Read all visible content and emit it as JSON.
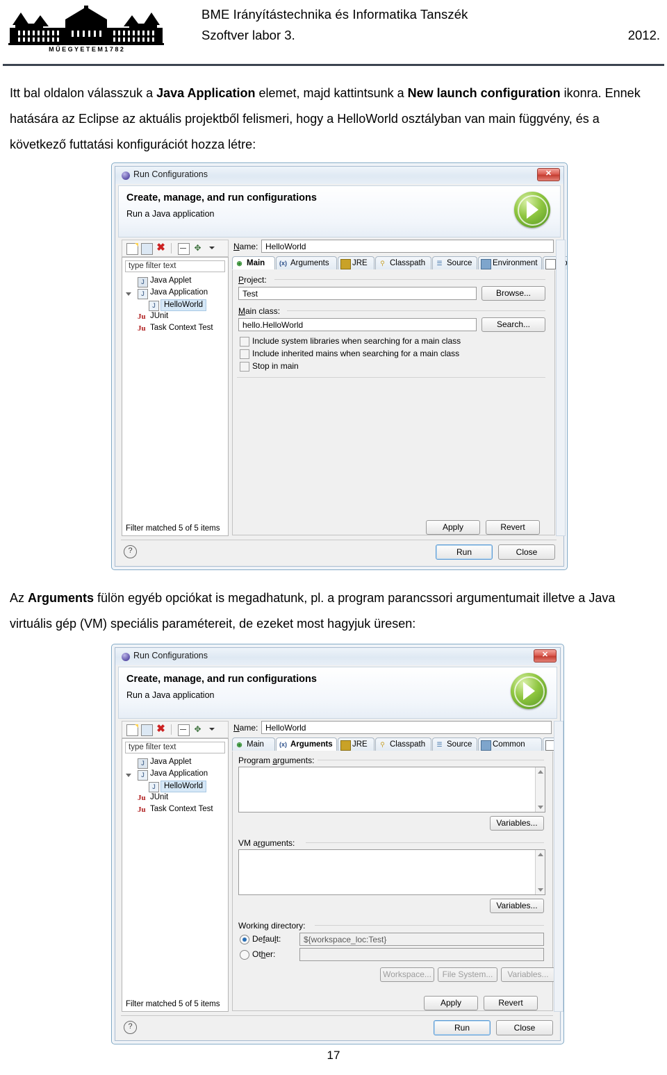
{
  "header": {
    "org": "BME Irányítástechnika és Informatika Tanszék",
    "course": "Szoftver labor 3.",
    "year": "2012.",
    "logo_caption": "M Ű E G Y E T E M  1 7 8 2"
  },
  "paragraphs": {
    "p1_a": "Itt bal oldalon válasszuk a ",
    "p1_b1": "Java Application",
    "p1_c": " elemet, majd kattintsunk a ",
    "p1_b2": "New launch configuration",
    "p1_d": " ikonra. Ennek hatására az Eclipse az aktuális projektből felismeri, hogy a HelloWorld osztályban van main függvény, és a következő futtatási konfigurációt hozza létre:",
    "p2_a": "Az ",
    "p2_b1": "Arguments",
    "p2_c": " fülön egyéb opciókat is megadhatunk, pl. a program parancssori argumentumait illetve a Java virtuális gép (VM) speciális paramétereit, de ezeket most hagyjuk üresen:"
  },
  "page_number": "17",
  "dialog": {
    "title": "Run Configurations",
    "close_label": "✕",
    "band_title": "Create, manage, and run configurations",
    "band_subtitle": "Run a Java application",
    "toolbar": {
      "new_icon": "new-launch-configuration-icon",
      "duplicate_icon": "duplicate-icon",
      "delete_icon": "✖",
      "collapse_icon": "collapse-all-icon",
      "filter_icon": "✥",
      "caret_icon": "chevron-down-icon"
    },
    "filter_placeholder": "type filter text",
    "tree": [
      {
        "label": "Java Applet",
        "icon": "J",
        "indent": 18,
        "selected": false,
        "arrow": "none"
      },
      {
        "label": "Java Application",
        "icon": "J",
        "indent": 18,
        "selected": false,
        "arrow": "open"
      },
      {
        "label": "HelloWorld",
        "icon": "J",
        "indent": 34,
        "selected": true,
        "arrow": "none"
      },
      {
        "label": "JUnit",
        "icon": "Ju",
        "indent": 18,
        "selected": false,
        "arrow": "none"
      },
      {
        "label": "Task Context Test",
        "icon": "Ju",
        "indent": 18,
        "selected": false,
        "arrow": "none"
      }
    ],
    "tree_status": "Filter matched 5 of 5 items",
    "name_label": "Name:",
    "name_value": "HelloWorld",
    "tabs": [
      {
        "label": "Main",
        "icon": "main-icon"
      },
      {
        "label": "Arguments",
        "icon": "arguments-icon"
      },
      {
        "label": "JRE",
        "icon": "jre-icon"
      },
      {
        "label": "Classpath",
        "icon": "classpath-icon"
      },
      {
        "label": "Source",
        "icon": "source-icon"
      },
      {
        "label": "Environment",
        "icon": "environment-icon"
      },
      {
        "label": "Common",
        "icon": "common-icon"
      }
    ],
    "buttons": {
      "apply": "Apply",
      "revert": "Revert",
      "run": "Run",
      "close": "Close",
      "help": "?"
    }
  },
  "main_tab": {
    "active_tab": "Main",
    "project_label": "Project:",
    "project_value": "Test",
    "browse_label": "Browse...",
    "mainclass_label": "Main class:",
    "mainclass_value": "hello.HelloWorld",
    "search_label": "Search...",
    "checkboxes": [
      {
        "label": "Include system libraries when searching for a main class",
        "checked": false
      },
      {
        "label": "Include inherited mains when searching for a main class",
        "checked": false
      },
      {
        "label": "Stop in main",
        "checked": false
      }
    ]
  },
  "arguments_tab": {
    "active_tab": "Arguments",
    "program_args_label": "Program arguments:",
    "program_args_value": "",
    "program_variables_label": "Variables...",
    "vm_args_label": "VM arguments:",
    "vm_args_value": "",
    "vm_variables_label": "Variables...",
    "working_dir_label": "Working directory:",
    "default_label": "Default:",
    "default_value": "${workspace_loc:Test}",
    "default_selected": true,
    "other_label": "Other:",
    "other_value": "",
    "other_selected": false,
    "workspace_btn": "Workspace...",
    "filesystem_btn": "File System...",
    "variables_btn": "Variables..."
  }
}
